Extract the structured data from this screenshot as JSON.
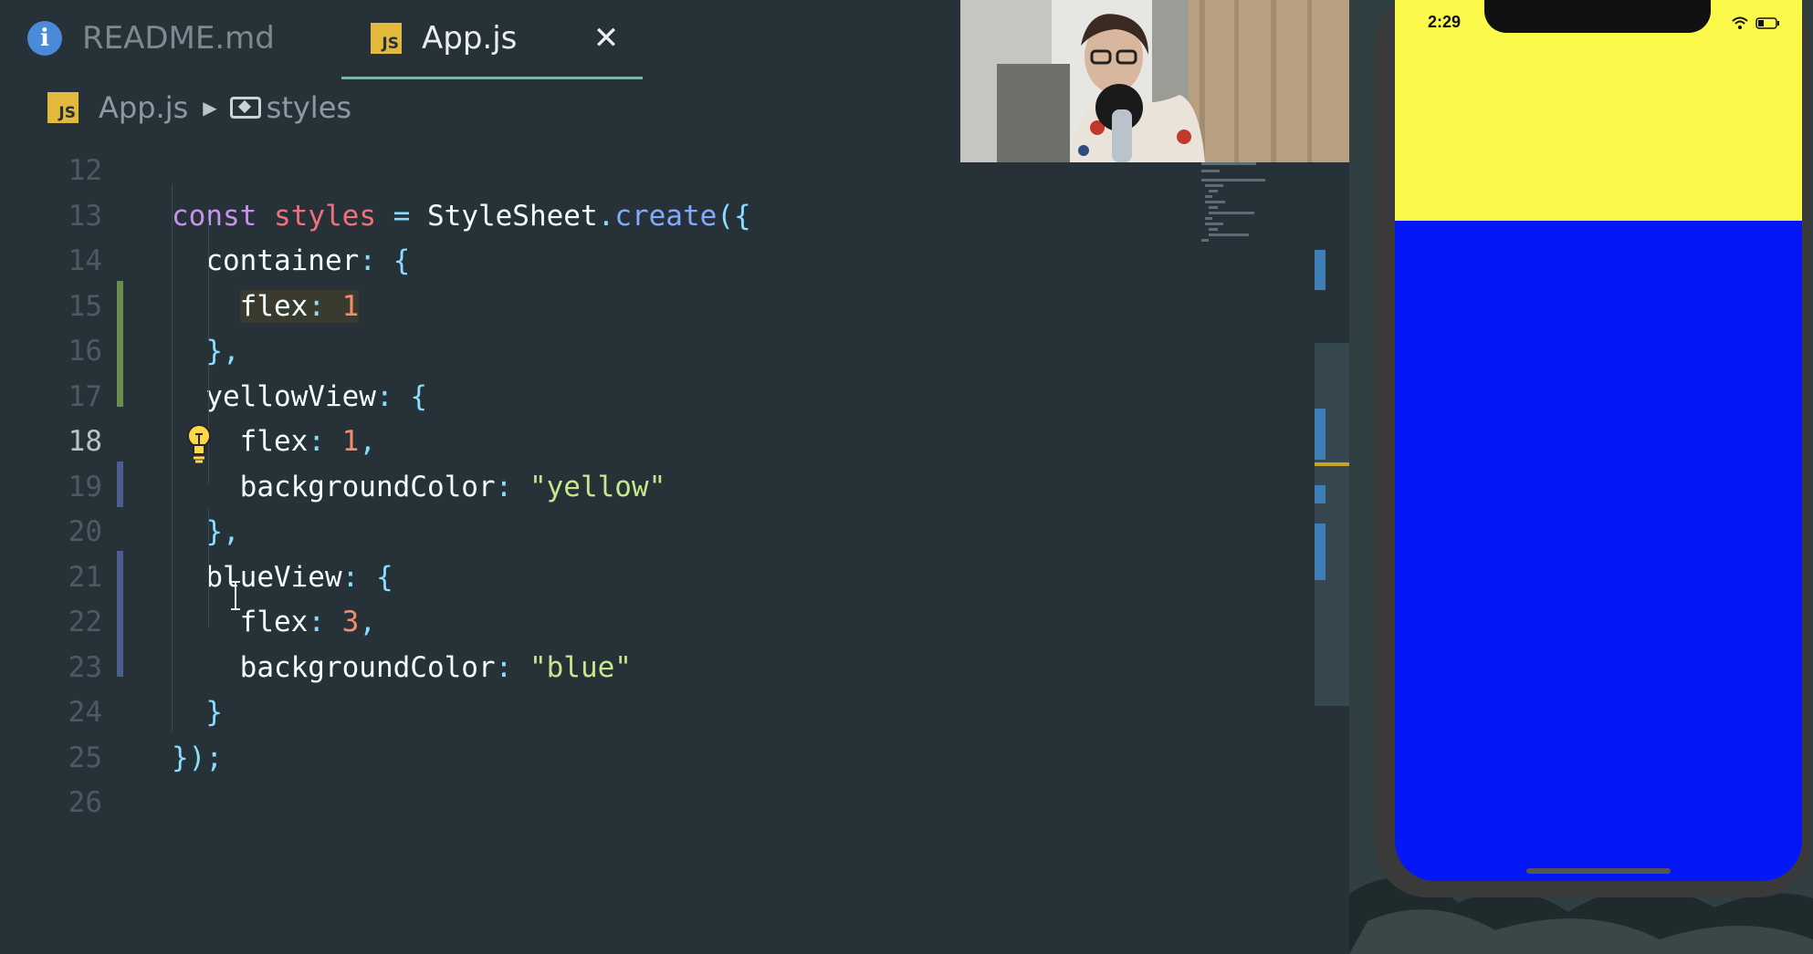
{
  "tabs": [
    {
      "label": "README.md",
      "icon": "info-icon",
      "active": false
    },
    {
      "label": "App.js",
      "icon": "js-file-icon",
      "active": true,
      "close_glyph": "✕"
    }
  ],
  "js_icon_text": "JS",
  "breadcrumb": {
    "file": "App.js",
    "symbol": "styles"
  },
  "code_lines": [
    {
      "n": "12",
      "t": "    "
    },
    {
      "n": "13",
      "t": "const styles = StyleSheet.create({"
    },
    {
      "n": "14",
      "t": "  container: {"
    },
    {
      "n": "15",
      "t": "    flex: 1"
    },
    {
      "n": "16",
      "t": "  },"
    },
    {
      "n": "17",
      "t": "  yellowView: {"
    },
    {
      "n": "18",
      "t": "    flex: 1,"
    },
    {
      "n": "19",
      "t": "    backgroundColor: \"yellow\""
    },
    {
      "n": "20",
      "t": "  },"
    },
    {
      "n": "21",
      "t": "  blueView: {"
    },
    {
      "n": "22",
      "t": "    flex: 3,"
    },
    {
      "n": "23",
      "t": "    backgroundColor: \"blue\""
    },
    {
      "n": "24",
      "t": "  }"
    },
    {
      "n": "25",
      "t": "});"
    },
    {
      "n": "26",
      "t": ""
    }
  ],
  "active_line": "18",
  "simulator": {
    "time": "2:29",
    "top_color": "#fbfa4a",
    "bottom_color": "#0418f5"
  },
  "colors": {
    "editor_bg": "#263238",
    "keyword": "#c792ea",
    "variable": "#f07178",
    "function": "#82aaff",
    "number": "#f78c6c",
    "string": "#c3e88d",
    "punctuation": "#89ddff"
  }
}
